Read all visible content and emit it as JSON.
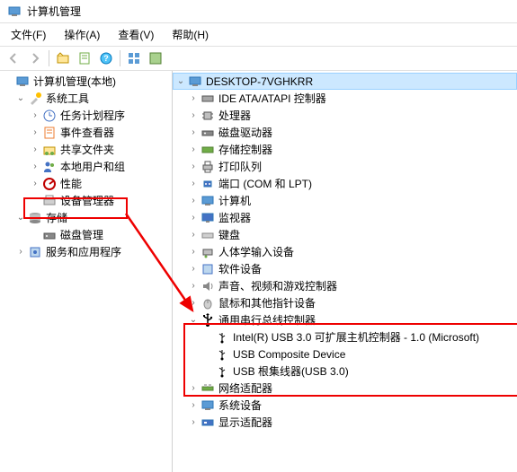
{
  "window": {
    "title": "计算机管理"
  },
  "menu": {
    "file": "文件(F)",
    "action": "操作(A)",
    "view": "查看(V)",
    "help": "帮助(H)"
  },
  "left_tree": {
    "root": "计算机管理(本地)",
    "system_tools": "系统工具",
    "task_scheduler": "任务计划程序",
    "event_viewer": "事件查看器",
    "shared_folders": "共享文件夹",
    "local_users": "本地用户和组",
    "performance": "性能",
    "device_manager": "设备管理器",
    "storage": "存储",
    "disk_mgmt": "磁盘管理",
    "services_apps": "服务和应用程序"
  },
  "right_tree": {
    "computer": "DESKTOP-7VGHKRR",
    "ide": "IDE ATA/ATAPI 控制器",
    "cpu": "处理器",
    "disk_drives": "磁盘驱动器",
    "storage_ctrl": "存储控制器",
    "print_queues": "打印队列",
    "ports": "端口 (COM 和 LPT)",
    "computers": "计算机",
    "monitors": "监视器",
    "keyboards": "键盘",
    "hid": "人体学输入设备",
    "software": "软件设备",
    "sound": "声音、视频和游戏控制器",
    "mice": "鼠标和其他指针设备",
    "usb": "通用串行总线控制器",
    "usb_intel": "Intel(R) USB 3.0 可扩展主机控制器 - 1.0 (Microsoft)",
    "usb_composite": "USB Composite Device",
    "usb_hub": "USB 根集线器(USB 3.0)",
    "network": "网络适配器",
    "sys_devices": "系统设备",
    "display": "显示适配器"
  }
}
